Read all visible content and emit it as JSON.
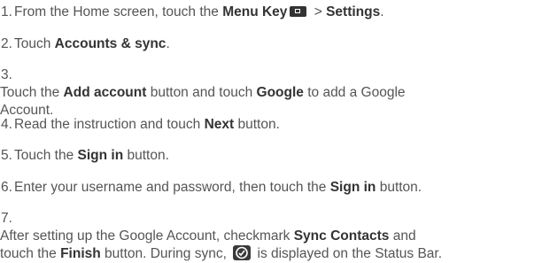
{
  "steps": [
    {
      "number": "1.",
      "text": {
        "a": "From the Home screen, touch the ",
        "b": "Menu Key",
        "c": " > ",
        "d": "Settings",
        "e": "."
      },
      "icon": "menu-key-icon"
    },
    {
      "number": "2.",
      "text": {
        "a": "Touch ",
        "b": "Accounts & sync",
        "c": "."
      }
    },
    {
      "number": "3.",
      "text": {
        "a": "Touch the ",
        "b": "Add account",
        "c": " button and touch ",
        "d": "Google",
        "e": " to add a Google",
        "f": "Account."
      }
    },
    {
      "number": "4.",
      "text": {
        "a": "Read the instruction and touch ",
        "b": "Next",
        "c": " button."
      }
    },
    {
      "number": "5.",
      "text": {
        "a": "Touch the ",
        "b": "Sign in",
        "c": " button."
      }
    },
    {
      "number": "6.",
      "text": {
        "a": "Enter your username and password, then touch the ",
        "b": "Sign in",
        "c": " button."
      }
    },
    {
      "number": "7.",
      "text": {
        "a": "After setting up the Google Account, checkmark ",
        "b": "Sync Contacts",
        "c": " and",
        "d": "touch the ",
        "e": "Finish",
        "f": " button. During sync, ",
        "g": " is displayed on the Status Bar."
      },
      "icon": "sync-icon"
    }
  ],
  "colors": {
    "body_text": "#555555",
    "keyword_text": "#333333",
    "icon_fill": "#333333"
  }
}
